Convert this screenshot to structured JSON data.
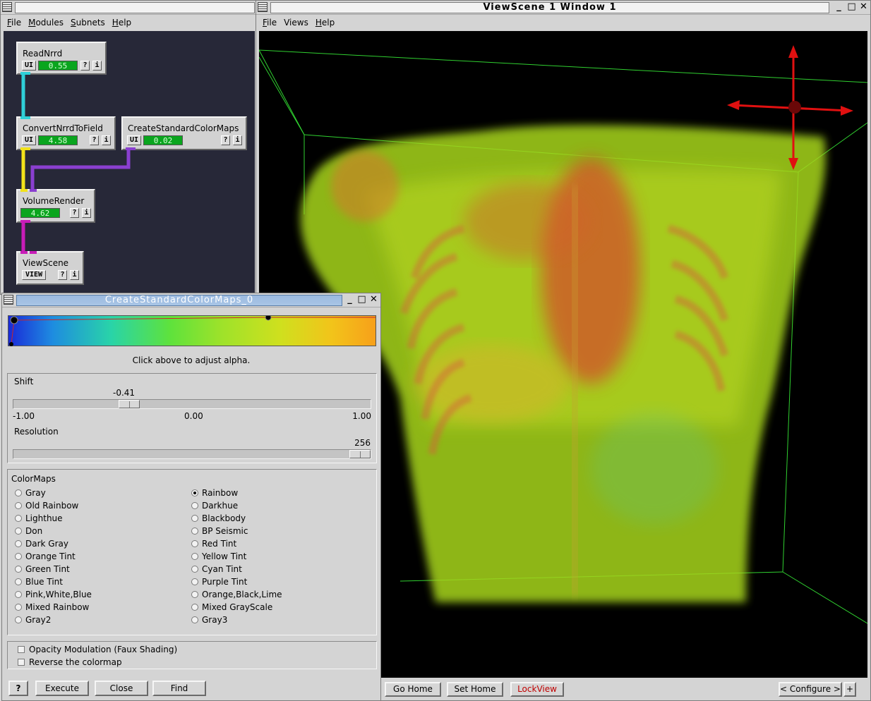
{
  "network_window": {
    "menu": [
      "File",
      "Modules",
      "Subnets",
      "Help"
    ],
    "modules": [
      {
        "name": "ReadNrrd",
        "ui": "UI",
        "progress": "0.55",
        "q": "?",
        "i": "i"
      },
      {
        "name": "ConvertNrrdToField",
        "ui": "UI",
        "progress": "4.58",
        "q": "?",
        "i": "i"
      },
      {
        "name": "CreateStandardColorMaps",
        "ui": "UI",
        "progress": "0.02",
        "q": "?",
        "i": "i"
      },
      {
        "name": "VolumeRender",
        "progress": "4.62",
        "q": "?",
        "i": "i"
      },
      {
        "name": "ViewScene",
        "view": "VIEW",
        "q": "?",
        "i": "i"
      }
    ],
    "colors": {
      "cyan": "#2fd0d8",
      "yellow": "#f2e21a",
      "purple": "#8a3fd0",
      "magenta": "#c81cb8"
    }
  },
  "viewer_window": {
    "title": "ViewScene 1 Window 1",
    "menu": [
      "File",
      "Views",
      "Help"
    ],
    "buttons": {
      "go_home": "Go Home",
      "set_home": "Set Home",
      "lock_view": "LockView",
      "configure": "< Configure >",
      "plus": "+"
    }
  },
  "colormap_dialog": {
    "title": "CreateStandardColorMaps_0",
    "alpha_hint": "Click above to adjust alpha.",
    "shift": {
      "label": "Shift",
      "value": "-0.41",
      "min": "-1.00",
      "mid": "0.00",
      "max": "1.00",
      "fraction": 0.295
    },
    "resolution": {
      "label": "Resolution",
      "value": "256",
      "fraction": 1.0
    },
    "colormaps_label": "ColorMaps",
    "left_options": [
      "Gray",
      "Old Rainbow",
      "Lighthue",
      "Don",
      "Dark Gray",
      "Orange Tint",
      "Green Tint",
      "Blue Tint",
      "Pink,White,Blue",
      "Mixed Rainbow",
      "Gray2"
    ],
    "right_options": [
      "Rainbow",
      "Darkhue",
      "Blackbody",
      "BP Seismic",
      "Red Tint",
      "Yellow Tint",
      "Cyan Tint",
      "Purple Tint",
      "Orange,Black,Lime",
      "Mixed GrayScale",
      "Gray3"
    ],
    "selected": "Rainbow",
    "opacity_modulation": "Opacity Modulation (Faux Shading)",
    "reverse": "Reverse the colormap",
    "buttons": {
      "help": "?",
      "execute": "Execute",
      "close": "Close",
      "find": "Find"
    }
  }
}
